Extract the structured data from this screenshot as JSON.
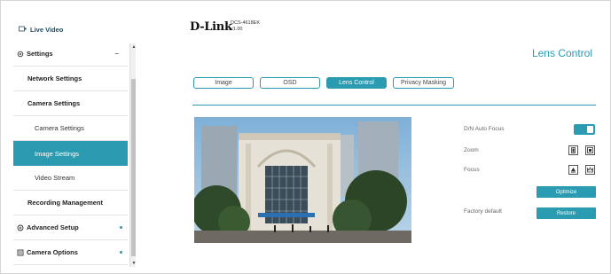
{
  "sidebar": {
    "live_video": "Live Video",
    "items": [
      {
        "label": "Settings",
        "sign": "–"
      },
      {
        "label": "Network Settings"
      },
      {
        "label": "Camera Settings"
      },
      {
        "label": "Camera Settings"
      },
      {
        "label": "Image Settings"
      },
      {
        "label": "Video Stream"
      },
      {
        "label": "Recording Management"
      },
      {
        "label": "Advanced Setup"
      },
      {
        "label": "Camera Options"
      }
    ]
  },
  "header": {
    "logo": "D-Link",
    "model": "DCS-4618EK",
    "version": "v1.00",
    "page_title": "Lens Control"
  },
  "tabs": [
    "Image",
    "OSD",
    "Lens Control",
    "Privacy Masking"
  ],
  "controls": {
    "dn_auto_focus": "D/N Auto Focus",
    "zoom": "Zoom",
    "focus": "Focus",
    "optimize": "Optimize",
    "factory_default": "Factory default",
    "restore": "Restore"
  },
  "colors": {
    "accent": "#2a9bb0"
  }
}
